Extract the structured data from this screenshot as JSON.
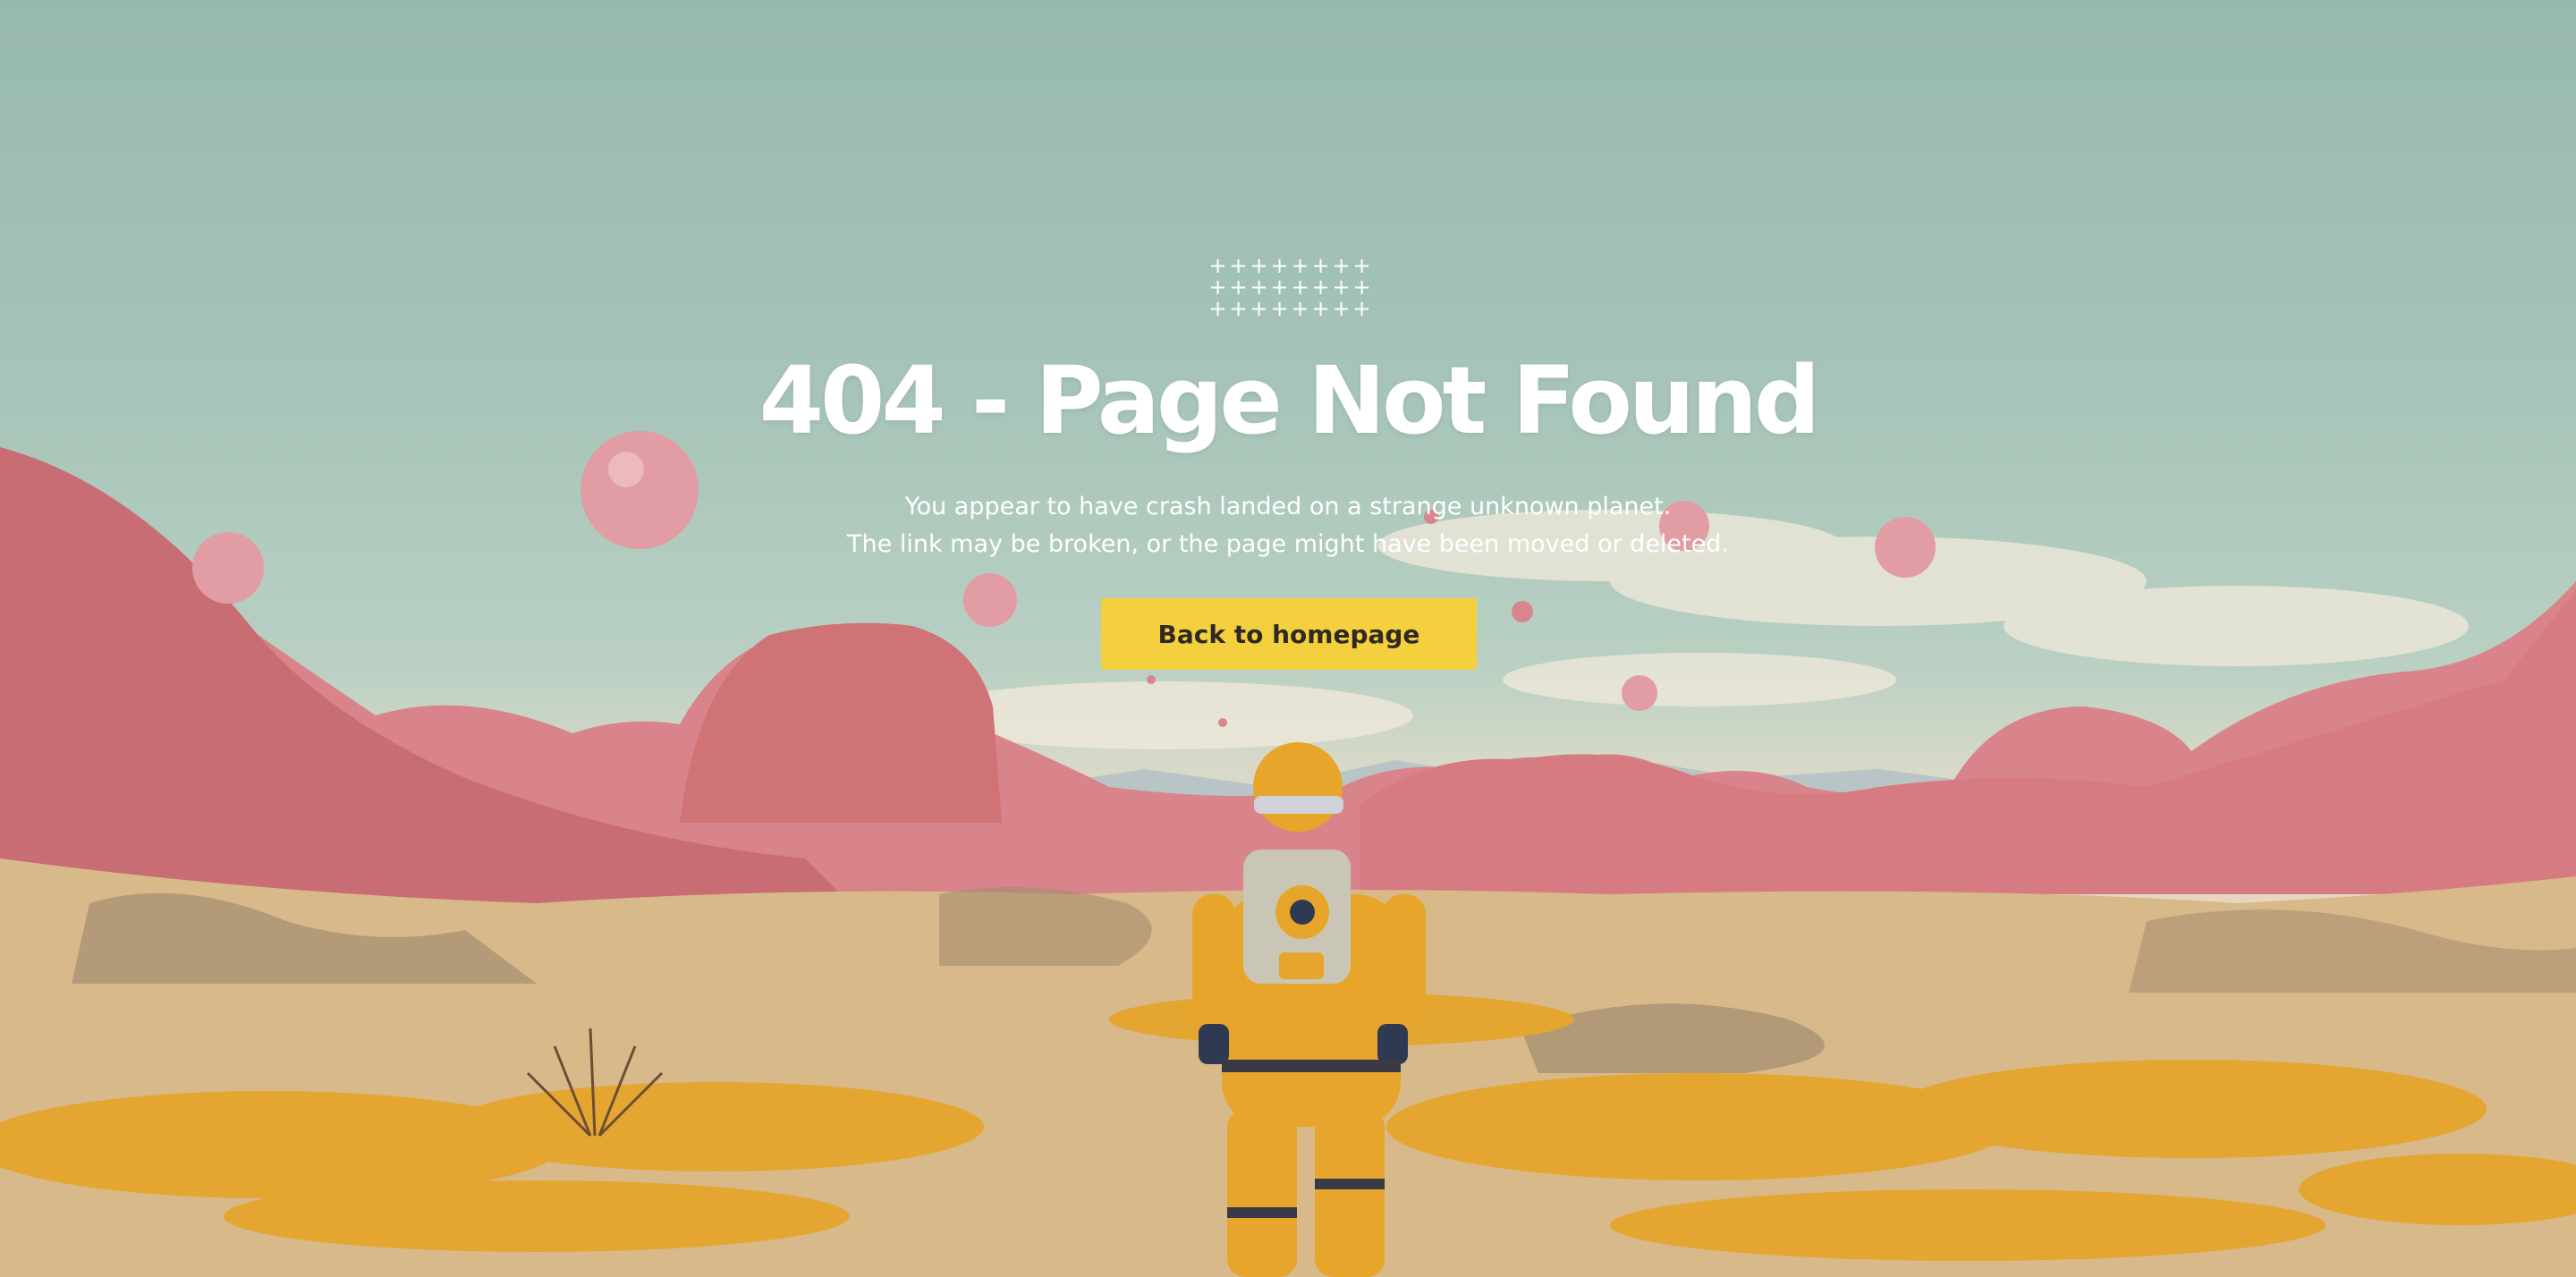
{
  "page": {
    "title": "404 -  Page Not Found",
    "subtitle_lines": [
      "You appear to have crash landed on a strange unknown planet.",
      "The link may be broken, or the page might have been moved or deleted."
    ],
    "cta_label": "Back to homepage"
  },
  "decoration": {
    "plus_pattern_icon": "plus-grid-icon",
    "plus_rows": 3,
    "plus_cols": 8
  },
  "colors": {
    "button": "#f5d03e",
    "button_text": "#2e2a22",
    "title": "#ffffff",
    "sky": "#9fbfb2",
    "hills": "#d9838a",
    "grass": "#e4a631",
    "astronaut_suit": "#e8a52c"
  }
}
